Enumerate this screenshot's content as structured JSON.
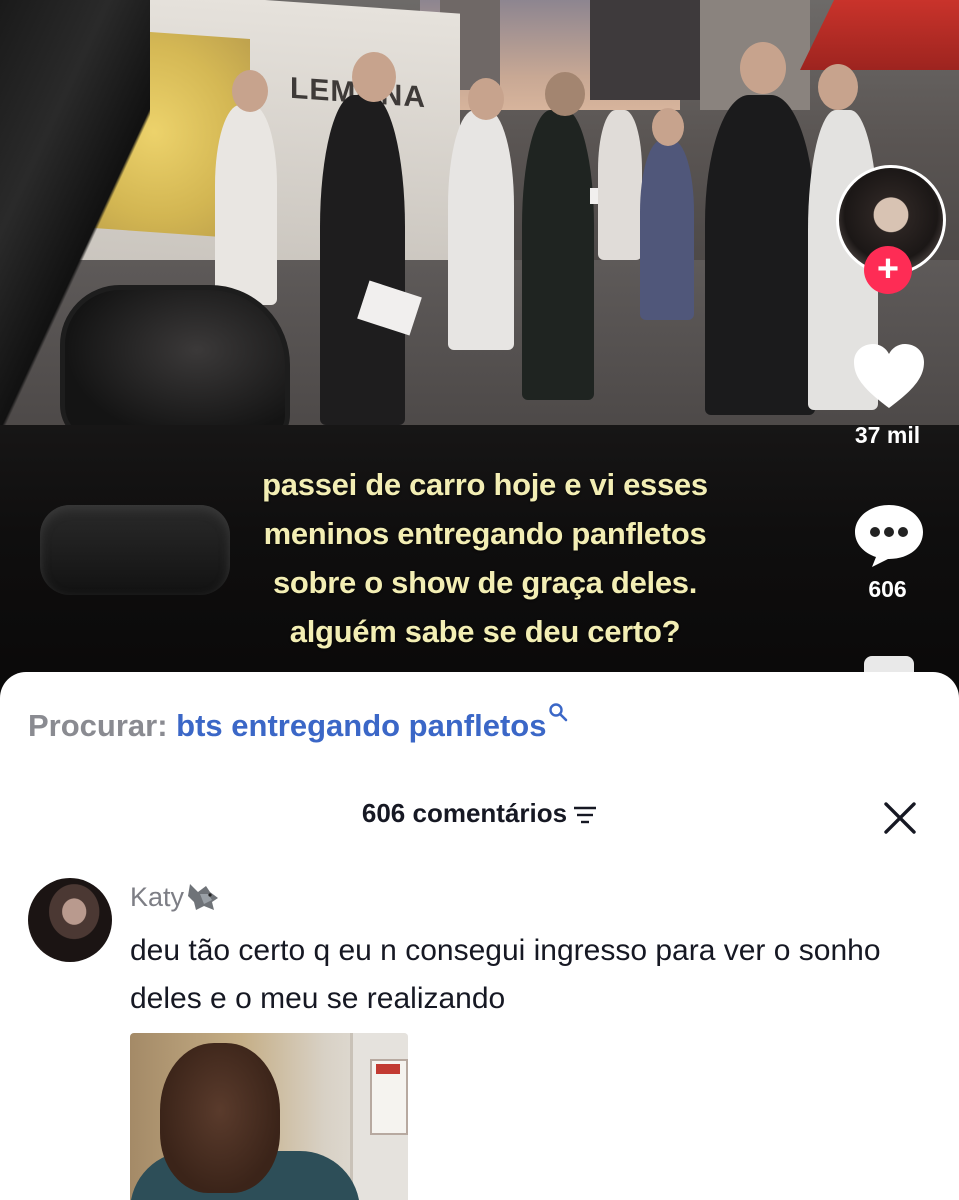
{
  "video": {
    "background_sign_text": "LEMONA",
    "caption_lines": [
      "passei de carro hoje e vi esses",
      "meninos entregando panfletos",
      "sobre o show de graça deles.",
      "alguém sabe se deu certo?"
    ]
  },
  "rail": {
    "follow_label": "+",
    "likes": "37 mil",
    "comments": "606",
    "icons": [
      "creator-avatar",
      "heart-icon",
      "comment-icon",
      "share-icon"
    ]
  },
  "sheet": {
    "search_label": "Procurar:",
    "search_query": "bts entregando panfletos",
    "comments_header": "606 comentários",
    "icons": [
      "magnifier-icon",
      "sort-icon",
      "close-icon"
    ]
  },
  "comment": {
    "username": "Katy",
    "text": "deu tão certo q eu n consegui ingresso para ver o sonho deles e o meu se realizando",
    "emoji_icon": "wolf-emoji-icon"
  },
  "colors": {
    "caption": "#f3eeb4",
    "follow": "#fe2c55",
    "search_query": "#3b67c7",
    "sheet_bg": "#ffffff"
  }
}
